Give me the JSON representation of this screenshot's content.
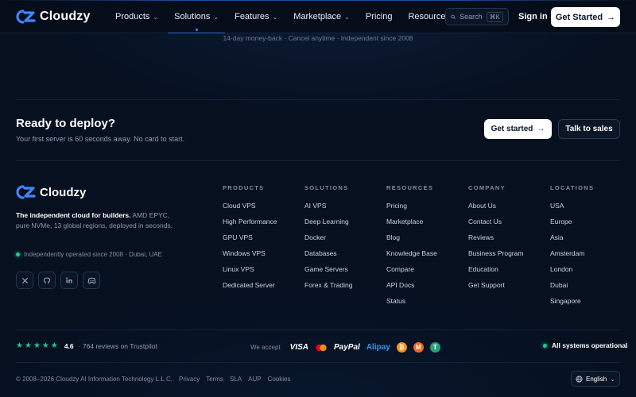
{
  "nav": {
    "brand": "Cloudzy",
    "items": [
      {
        "label": "Products",
        "chevron": true
      },
      {
        "label": "Solutions",
        "chevron": true,
        "active": true
      },
      {
        "label": "Features",
        "chevron": true
      },
      {
        "label": "Marketplace",
        "chevron": true
      },
      {
        "label": "Pricing",
        "chevron": false
      },
      {
        "label": "Resources",
        "chevron": true
      }
    ],
    "search_label": "Search",
    "search_shortcut": "⌘K",
    "signin": "Sign in",
    "get_started": "Get Started"
  },
  "subnote": "14-day money-back · Cancel anytime · Independent since 2008",
  "cta": {
    "title": "Ready to deploy?",
    "subtitle": "Your first server is 60 seconds away. No card to start.",
    "primary": "Get started",
    "secondary": "Talk to sales"
  },
  "footer": {
    "brand": "Cloudzy",
    "tagline_bold": "The independent cloud for builders.",
    "tagline_rest": " AMD EPYC, pure NVMe, 13 global regions, deployed in seconds.",
    "operated": "Independently operated since 2008 · Dubai, UAE",
    "socials": [
      "x-icon",
      "github-icon",
      "linkedin-icon",
      "discord-icon"
    ],
    "columns": [
      {
        "title": "PRODUCTS",
        "links": [
          "Cloud VPS",
          "High Performance",
          "GPU VPS",
          "Windows VPS",
          "Linux VPS",
          "Dedicated Server"
        ]
      },
      {
        "title": "SOLUTIONS",
        "links": [
          "AI VPS",
          "Deep Learning",
          "Docker",
          "Databases",
          "Game Servers",
          "Forex & Trading"
        ]
      },
      {
        "title": "RESOURCES",
        "links": [
          "Pricing",
          "Marketplace",
          "Blog",
          "Knowledge Base",
          "Compare",
          "API Docs",
          "Status"
        ]
      },
      {
        "title": "COMPANY",
        "links": [
          "About Us",
          "Contact Us",
          "Reviews",
          "Business Program",
          "Education",
          "Get Support"
        ]
      },
      {
        "title": "LOCATIONS",
        "links": [
          "USA",
          "Europe",
          "Asia",
          "Amsterdam",
          "London",
          "Dubai",
          "Singapore"
        ]
      }
    ]
  },
  "bottom": {
    "rating": "4.6",
    "reviews": "· 764 reviews on Trustpilot",
    "accept_label": "We accept",
    "visa": "VISA",
    "paypal": "PayPal",
    "alipay": "Alipay",
    "status": "All systems operational",
    "copyright": "© 2008–2026 Cloudzy AI Information Technology L.L.C.",
    "legal_links": [
      "Privacy",
      "Terms",
      "SLA",
      "AUP",
      "Cookies"
    ],
    "language": "English"
  },
  "colors": {
    "accent": "#3f86ff",
    "success": "#22c58b",
    "background": "#06101f"
  }
}
